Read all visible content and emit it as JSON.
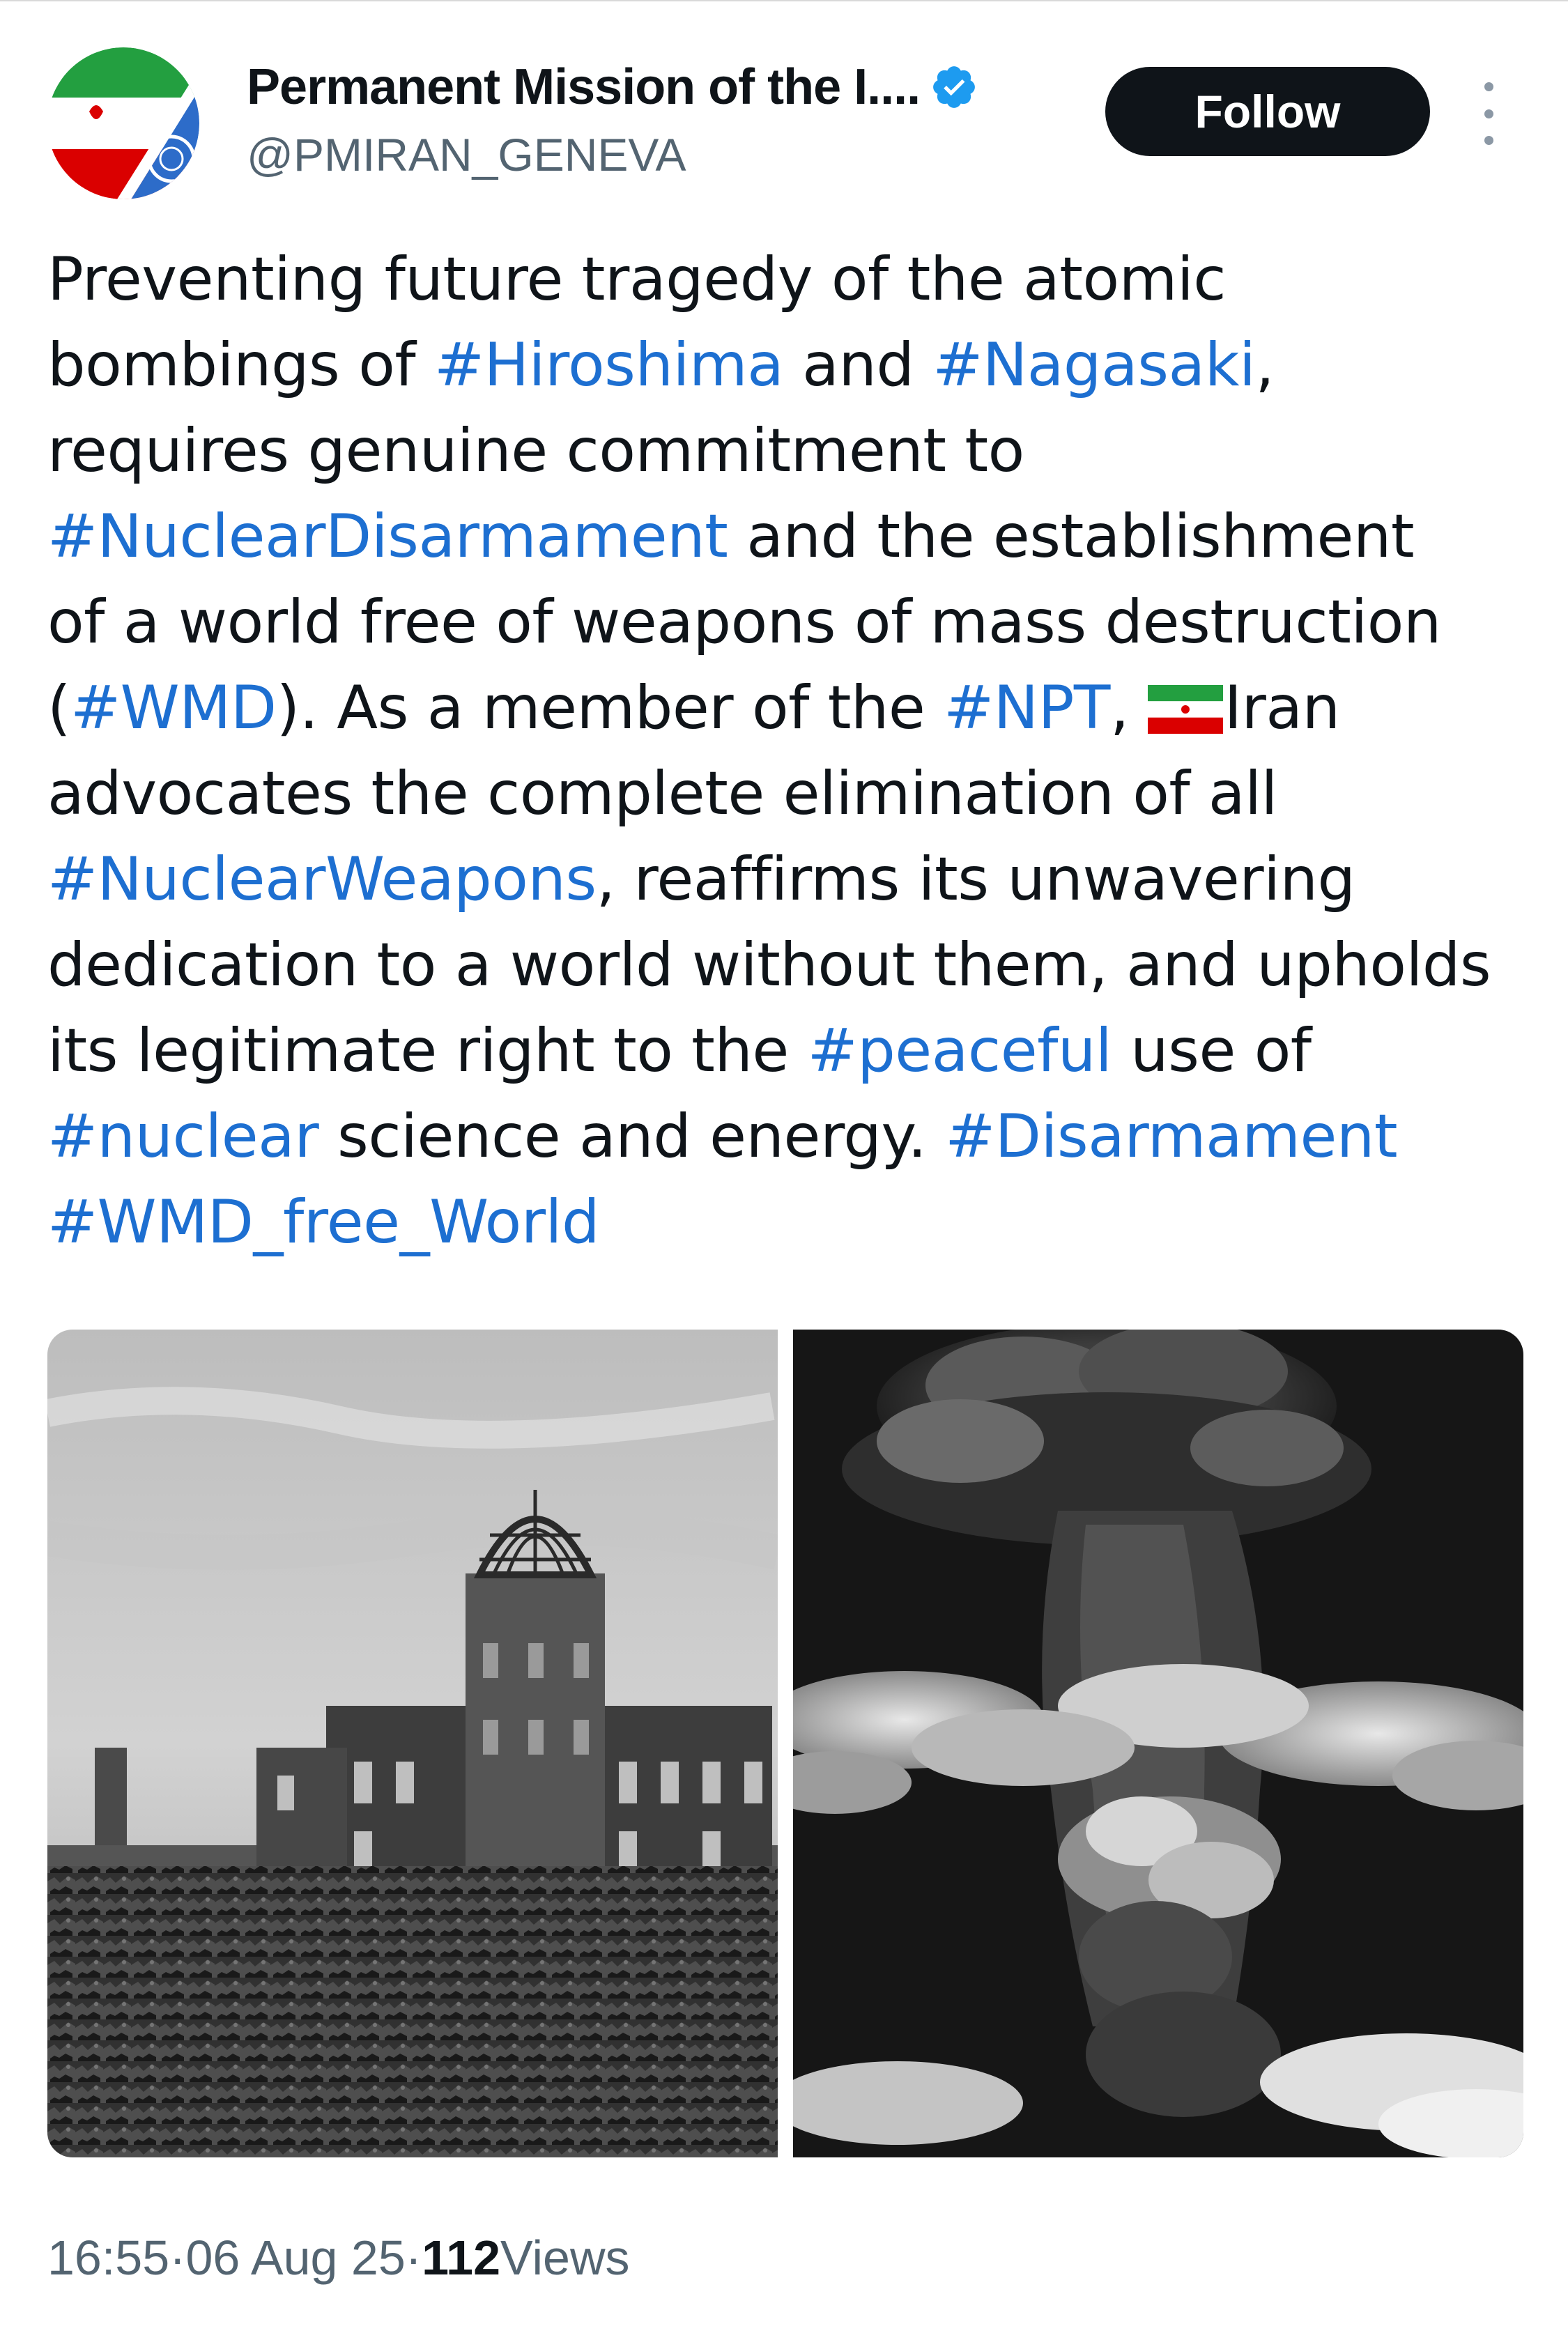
{
  "author": {
    "display_name": "Permanent Mission of the I....",
    "handle": "@PMIRAN_GENEVA",
    "verified": true
  },
  "follow_label": "Follow",
  "tweet": {
    "lines": [
      [
        {
          "t": "Preventing future tragedy of the atomic"
        }
      ],
      [
        {
          "t": "bombings of "
        },
        {
          "t": "#Hiroshima",
          "tag": true
        },
        {
          "t": " and "
        },
        {
          "t": "#Nagasaki",
          "tag": true
        },
        {
          "t": ","
        }
      ],
      [
        {
          "t": "requires genuine commitment to"
        }
      ],
      [
        {
          "t": "#NuclearDisarmament",
          "tag": true
        },
        {
          "t": " and the establishment"
        }
      ],
      [
        {
          "t": "of a world free of weapons of mass destruction"
        }
      ],
      [
        {
          "t": "("
        },
        {
          "t": "#WMD",
          "tag": true
        },
        {
          "t": "). As a member of the "
        },
        {
          "t": "#NPT",
          "tag": true
        },
        {
          "t": ", "
        },
        {
          "flag": "iran-flag-emoji"
        },
        {
          "t": "Iran"
        }
      ],
      [
        {
          "t": "advocates the complete elimination of all"
        }
      ],
      [
        {
          "t": "#NuclearWeapons",
          "tag": true
        },
        {
          "t": ", reaffirms its unwavering"
        }
      ],
      [
        {
          "t": "dedication to a world without them, and upholds"
        }
      ],
      [
        {
          "t": "its legitimate right to the "
        },
        {
          "t": "#peaceful",
          "tag": true
        },
        {
          "t": " use of"
        }
      ],
      [
        {
          "t": "#nuclear",
          "tag": true
        },
        {
          "t": " science and energy. "
        },
        {
          "t": "#Disarmament",
          "tag": true
        }
      ],
      [
        {
          "t": "#WMD_free_World",
          "tag": true
        }
      ]
    ]
  },
  "media": [
    {
      "name": "hiroshima-dome-ruins-photo"
    },
    {
      "name": "mushroom-cloud-photo"
    }
  ],
  "meta": {
    "time": "16:55",
    "sep1": " · ",
    "date": "06 Aug 25",
    "sep2": " · ",
    "views_count": "112",
    "views_label": " Views"
  },
  "colors": {
    "hashtag": "#1d6fd1",
    "follow_bg": "#0f1419",
    "verified": "#1d9bf0",
    "secondary_text": "#536471"
  }
}
